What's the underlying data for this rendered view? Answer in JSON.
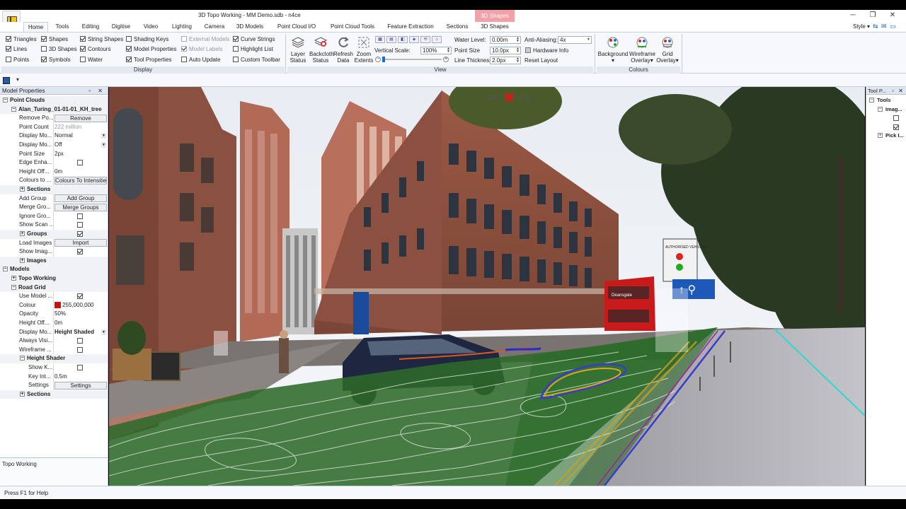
{
  "window": {
    "title": "3D Topo Working - MM Demo.sdb - n4ce",
    "context_tab": "3D Shapes",
    "minimize": "─",
    "maximize": "❐",
    "close": "✕"
  },
  "tabs": [
    "Home",
    "Tools",
    "Editing",
    "Digitise",
    "Video",
    "Lighting",
    "Camera",
    "3D Models",
    "Point Cloud I/O",
    "Point Cloud Tools",
    "Feature Extraction",
    "Sections",
    "3D Shapes"
  ],
  "style_menu": {
    "label": "Style",
    "arrow": "▾",
    "icons": "⇆ ✉ ▭"
  },
  "ribbon": {
    "display": {
      "label": "Display",
      "checks": [
        {
          "label": "Triangles",
          "on": true
        },
        {
          "label": "Lines",
          "on": true
        },
        {
          "label": "Points",
          "on": false
        },
        {
          "label": "Shapes",
          "on": true
        },
        {
          "label": "3D Shapes",
          "on": false
        },
        {
          "label": "Symbols",
          "on": true
        },
        {
          "label": "String Shapes",
          "on": true
        },
        {
          "label": "Contours",
          "on": true
        },
        {
          "label": "Water",
          "on": false
        },
        {
          "label": "Shading Keys",
          "on": false
        },
        {
          "label": "Model Properties",
          "on": true
        },
        {
          "label": "Tool Properties",
          "on": true
        },
        {
          "label": "External Models",
          "on": false,
          "disabled": true
        },
        {
          "label": "Model Labels",
          "on": true,
          "disabled": true
        },
        {
          "label": "Auto Update",
          "on": false
        },
        {
          "label": "Curve Strings",
          "on": true
        },
        {
          "label": "Highlight List",
          "on": false
        },
        {
          "label": "Custom Toolbar",
          "on": false
        }
      ]
    },
    "view": {
      "label": "View",
      "buttons": [
        {
          "label": "Layer\nStatus"
        },
        {
          "label": "Backcloth\nStatus"
        },
        {
          "label": "Refresh\nData"
        },
        {
          "label": "Zoom\nExtents"
        }
      ],
      "vertical_scale_label": "Vertical Scale:",
      "vertical_scale_value": "100%",
      "water_level_label": "Water Level:",
      "water_level_value": "0.00m",
      "point_size_label": "Point Size",
      "point_size_value": "10.0px",
      "line_thickness_label": "Line Thickness",
      "line_thickness_value": "2.0px",
      "anti_aliasing_label": "Anti-Aliasing:",
      "anti_aliasing_value": "4x",
      "hardware_info": "Hardware Info",
      "reset_layout": "Reset Layout"
    },
    "colours": {
      "label": "Colours",
      "buttons": [
        {
          "label": "Background",
          "sub": "▾"
        },
        {
          "label": "Wireframe\nOverlay",
          "sub": "▾"
        },
        {
          "label": "Grid\nOverlay",
          "sub": "▾"
        }
      ]
    }
  },
  "left_panel": {
    "title": "Model Properties",
    "controls": "▫ ✕",
    "rows": [
      {
        "kind": "cat",
        "level": 0,
        "exp": "−",
        "name": "Point Clouds"
      },
      {
        "kind": "cat",
        "level": 1,
        "exp": "−",
        "name": "Alan_Turing_01-01-01_KH_tree"
      },
      {
        "name": "Remove Po...",
        "btn": "Remove"
      },
      {
        "name": "Point Count",
        "val": "222 million",
        "gray": true
      },
      {
        "name": "Display Mo...",
        "val": "Normal",
        "drop": true
      },
      {
        "name": "Display Mo...",
        "val": "Off",
        "drop": true
      },
      {
        "name": "Point Size",
        "val": "2px"
      },
      {
        "name": "Edge Enha...",
        "check": false
      },
      {
        "name": "Height Off...",
        "val": "0m"
      },
      {
        "name": "Colours to ...",
        "btn": "Colours To Intensities"
      },
      {
        "kind": "cat",
        "level": 2,
        "exp": "+",
        "name": "Sections"
      },
      {
        "name": "Add Group",
        "btn": "Add Group"
      },
      {
        "name": "Merge Gro...",
        "btn": "Merge Groups"
      },
      {
        "name": "Ignore Gro...",
        "check": false
      },
      {
        "name": "Show Scan ...",
        "check": false
      },
      {
        "kind": "cat",
        "level": 2,
        "exp": "+",
        "name": "Groups",
        "check": true
      },
      {
        "name": "Load Images",
        "btn": "Import"
      },
      {
        "name": "Show Imag...",
        "check": true
      },
      {
        "kind": "cat",
        "level": 2,
        "exp": "+",
        "name": "Images"
      },
      {
        "kind": "cat",
        "level": 0,
        "exp": "−",
        "name": "Models"
      },
      {
        "kind": "cat",
        "level": 1,
        "exp": "+",
        "name": "Topo Working"
      },
      {
        "kind": "cat",
        "level": 1,
        "exp": "−",
        "name": "Road Grid"
      },
      {
        "name": "Use Model ...",
        "check": true
      },
      {
        "name": "Colour",
        "val": "255,000,000",
        "swatch": "#cc1010"
      },
      {
        "name": "Opacity",
        "val": "50%"
      },
      {
        "name": "Height Off...",
        "val": "0m"
      },
      {
        "name": "Display Mo...",
        "val": "Height Shaded",
        "drop": true,
        "bold": true
      },
      {
        "name": "Always Visi...",
        "check": false
      },
      {
        "name": "Wireframe ...",
        "check": false
      },
      {
        "kind": "cat",
        "level": 2,
        "exp": "−",
        "name": "Height Shader"
      },
      {
        "name": "Show K...",
        "check": false,
        "indent": true
      },
      {
        "name": "Key Int...",
        "val": "0.5m",
        "indent": true
      },
      {
        "name": "Settings",
        "btn": "Settings",
        "indent": true
      },
      {
        "kind": "cat",
        "level": 2,
        "exp": "+",
        "name": "Sections"
      }
    ],
    "description": "Topo Working"
  },
  "right_panel": {
    "title": "Tool P...",
    "controls": "▫ ✕",
    "rows": [
      {
        "exp": "−",
        "name": "Tools",
        "bold": true
      },
      {
        "exp": "−",
        "name": "Imag...",
        "bold": true,
        "indent": 1
      },
      {
        "check": false,
        "indent": 2
      },
      {
        "check": true,
        "indent": 2
      },
      {
        "exp": "+",
        "name": "Pick I...",
        "bold": true,
        "indent": 1
      }
    ]
  },
  "viewport": {
    "nav_prev": "⇦",
    "nav_close": "✖",
    "nav_next": "⇨",
    "bus_sign": "Deansgate",
    "street_sign": "AUTHORISED VEHICLES"
  },
  "status": {
    "text": "Press F1 for Help"
  }
}
